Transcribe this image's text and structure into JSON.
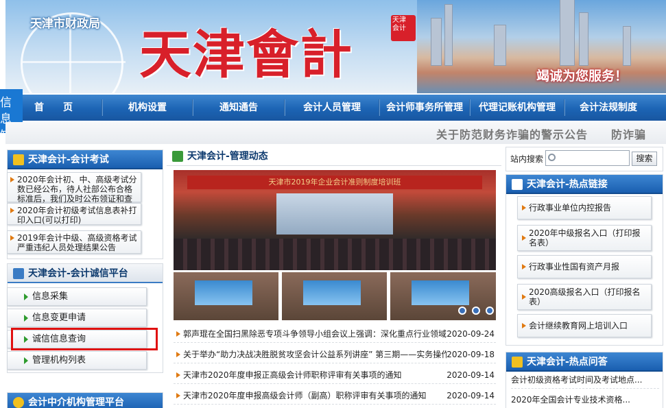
{
  "header": {
    "bureau_name": "天津市财政局",
    "site_title": "天津會計",
    "seal_text": "天津 会计",
    "slogan": "竭诚为您服务！"
  },
  "side_tab": {
    "label": "信息 知"
  },
  "nav": {
    "items": [
      {
        "label": "首　　页"
      },
      {
        "label": "机构设置"
      },
      {
        "label": "通知通告"
      },
      {
        "label": "会计人员管理"
      },
      {
        "label": "会计师事务所管理"
      },
      {
        "label": "代理记账机构管理"
      },
      {
        "label": "会计法规制度"
      }
    ]
  },
  "ticker": {
    "text": "关于防范财务诈骗的警示公告　　防诈骗"
  },
  "left": {
    "exam": {
      "title": "天津会计-会计考试",
      "items": [
        {
          "label": "2020年会计初、中、高级考试分数已经公布，待人社部公布合格标准后，我们及时公布领证和查卷通知"
        },
        {
          "label": "2020年会计初级考试信息表补打印入口(可以打印)"
        },
        {
          "label": "2019年会计中级、高级资格考试严重违纪人员处理结果公告"
        }
      ]
    },
    "integrity": {
      "title": "天津会计-会计诚信平台",
      "items": [
        {
          "label": "信息采集"
        },
        {
          "label": "信息变更申请"
        },
        {
          "label": "诚信信息查询"
        },
        {
          "label": "管理机构列表"
        }
      ]
    },
    "agency": {
      "title": "会计中介机构管理平台"
    }
  },
  "center": {
    "title": "天津会计-管理动态",
    "photo_banner": "天津市2019年企业会计准则制度培训班",
    "news": [
      {
        "title": "郭声琨在全国扫黑除恶专项斗争领导小组会议上强调：深化重点行业领域整治",
        "date": "2020-09-24"
      },
      {
        "title": "关于举办“助力决战决胜脱贫攻坚会计公益系列讲座” 第三期——实务操作",
        "date": "2020-09-18"
      },
      {
        "title": "天津市2020年度申报正高级会计师职称评审有关事项的通知",
        "date": "2020-09-14"
      },
      {
        "title": "天津市2020年度申报高级会计师（副高）职称评审有关事项的通知",
        "date": "2020-09-14"
      }
    ]
  },
  "right": {
    "search": {
      "label": "站内搜索",
      "placeholder": "",
      "button": "搜索"
    },
    "hot_links": {
      "title": "天津会计-热点链接",
      "items": [
        {
          "label": "行政事业单位内控报告"
        },
        {
          "label": "2020年中级报名入口（打印报名表）"
        },
        {
          "label": "行政事业性国有资产月报"
        },
        {
          "label": "2020高级报名入口（打印报名表）"
        },
        {
          "label": "会计继续教育网上培训入口"
        }
      ]
    },
    "faq": {
      "title": "天津会计-热点问答",
      "items": [
        {
          "label": "会计初级资格考试时间及考试地点..."
        },
        {
          "label": "2020年全国会计专业技术资格..."
        }
      ]
    }
  }
}
